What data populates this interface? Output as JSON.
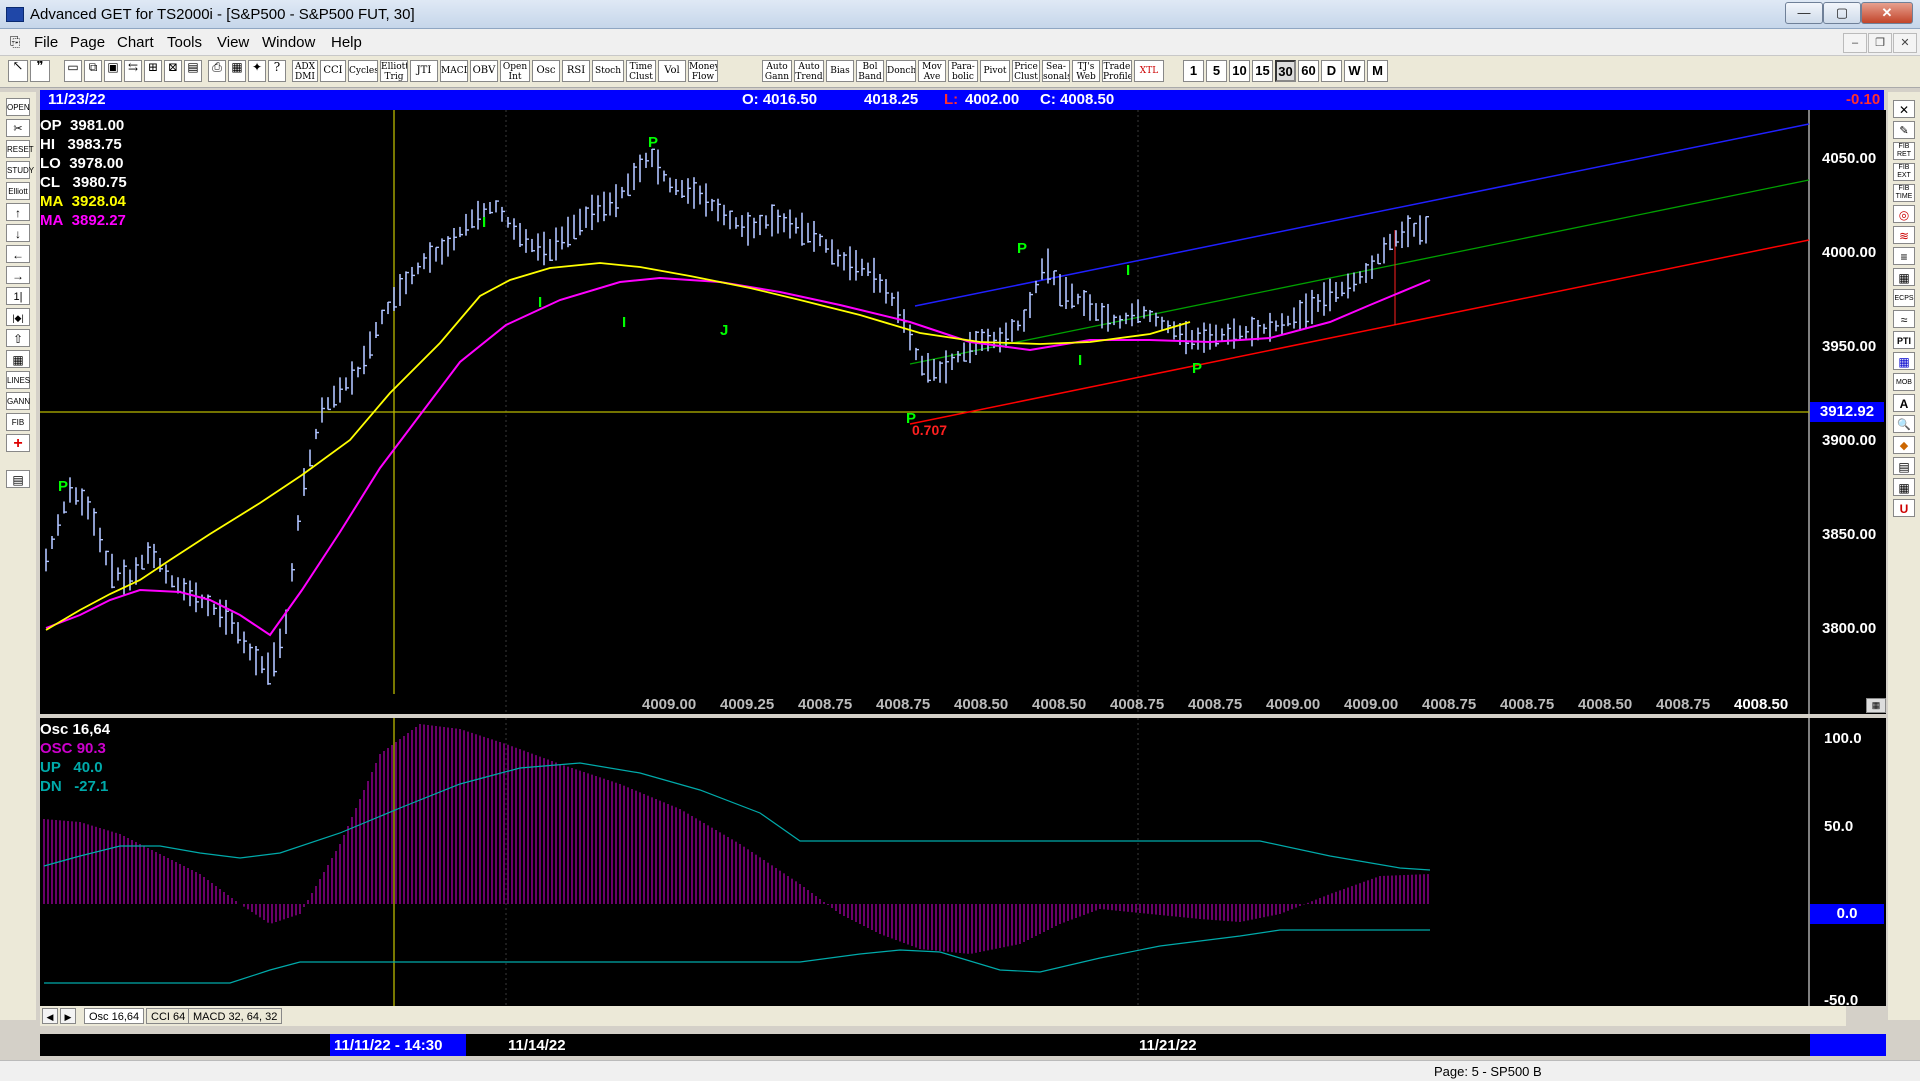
{
  "window": {
    "title": "Advanced GET for TS2000i - [S&P500 - S&P500 FUT, 30]",
    "minimize": "—",
    "maximize": "▢",
    "close": "✕"
  },
  "menu": [
    "File",
    "Page",
    "Chart",
    "Tools",
    "View",
    "Window",
    "Help"
  ],
  "toolbar": {
    "studies": [
      "ADX DMI",
      "CCI",
      "Cycles",
      "Elliott Trig",
      "JTI",
      "MACD",
      "OBV",
      "Open Int",
      "Osc",
      "RSI",
      "Stoch",
      "Time Clust",
      "Vol",
      "Money Flow",
      "Auto Gann",
      "Auto Trend",
      "Bias",
      "Bol Band",
      "Donch",
      "Mov Ave",
      "Para-bolic",
      "Pivot",
      "Price Clust",
      "Sea-sonals",
      "TJ's Web",
      "Trade Profile",
      "XTL"
    ],
    "timeframes": [
      "1",
      "5",
      "10",
      "15",
      "30",
      "60",
      "D",
      "W",
      "M"
    ],
    "selected_timeframe": "30"
  },
  "left_tools": [
    "OPEN",
    "",
    "RESET",
    "STUDY",
    "Elliott",
    "↑",
    "↓",
    "←",
    "→",
    "1|",
    "|◆|",
    "⇧",
    "▦",
    "LINES",
    "GANN",
    "FIB",
    "+",
    "",
    "▤"
  ],
  "right_tools": [
    "✕",
    "✎",
    "FIB RET",
    "FIB EXT",
    "FIB TIME",
    "◎",
    "≋",
    "≡",
    "▦",
    "ECPS",
    "≈",
    "PTI",
    "▦",
    "MOB",
    "A",
    "🔍",
    "◆",
    "▤",
    "▦",
    "U"
  ],
  "info_bar": {
    "date": "11/23/22",
    "open": "O: 4016.50",
    "high": "4018.25",
    "low_label": "L:",
    "low": "4002.00",
    "close": "C: 4008.50",
    "change": "-0.10"
  },
  "legend": [
    {
      "label": "OP",
      "value": "3981.00",
      "color": "#ffffff"
    },
    {
      "label": "HI",
      "value": "3983.75",
      "color": "#ffffff"
    },
    {
      "label": "LO",
      "value": "3978.00",
      "color": "#ffffff"
    },
    {
      "label": "CL",
      "value": "3980.75",
      "color": "#ffffff"
    },
    {
      "label": "MA",
      "value": "3928.04",
      "color": "#ffff00"
    },
    {
      "label": "MA",
      "value": "3892.27",
      "color": "#ff00ff"
    }
  ],
  "price_axis": {
    "ticks": [
      "4050.00",
      "4000.00",
      "3950.00",
      "3900.00",
      "3850.00",
      "3800.00"
    ],
    "current_price": "3912.92"
  },
  "price_markers": [
    {
      "text": "P",
      "color": "#00ff00"
    },
    {
      "text": "I",
      "color": "#00ff00"
    },
    {
      "text": "I",
      "color": "#00ff00"
    },
    {
      "text": "P",
      "color": "#00ff00"
    },
    {
      "text": "I",
      "color": "#00ff00"
    },
    {
      "text": "J",
      "color": "#00ff00"
    },
    {
      "text": "P",
      "color": "#00ff00"
    },
    {
      "text": "P",
      "color": "#00ff00"
    },
    {
      "text": "I",
      "color": "#00ff00"
    },
    {
      "text": "I",
      "color": "#00ff00"
    },
    {
      "text": "P",
      "color": "#00ff00"
    },
    {
      "text": "0.707",
      "color": "#ff0000"
    }
  ],
  "bottom_prices": [
    "4009.00",
    "4009.25",
    "4008.75",
    "4008.75",
    "4008.50",
    "4008.50",
    "4008.75",
    "4008.75",
    "4009.00",
    "4009.00",
    "4008.75",
    "4008.75",
    "4008.50",
    "4008.75",
    "4008.50"
  ],
  "oscillator": {
    "title": "Osc 16,64",
    "legend": [
      {
        "label": "OSC",
        "value": "90.3",
        "color": "#cc00cc"
      },
      {
        "label": "UP",
        "value": "40.0",
        "color": "#00aaaa"
      },
      {
        "label": "DN",
        "value": "-27.1",
        "color": "#00aaaa"
      }
    ],
    "axis_ticks": [
      "100.0",
      "50.0",
      "0.0",
      "-50.0"
    ]
  },
  "tabs": [
    "Osc 16,64",
    "CCI 64",
    "MACD 32, 64, 32"
  ],
  "nav": [
    "◀",
    "▶"
  ],
  "date_axis": {
    "cursor_label": "11/11/22 - 14:30",
    "labels": [
      "11/14/22",
      "11/21/22"
    ]
  },
  "status_bar": {
    "page": "Page: 5 - SP500 B"
  },
  "colors": {
    "blue_bar": "#0000ff",
    "ma_fast": "#ffff00",
    "ma_slow": "#ff00ff",
    "bars": "#b0c4ff",
    "markers": "#00ff00"
  }
}
